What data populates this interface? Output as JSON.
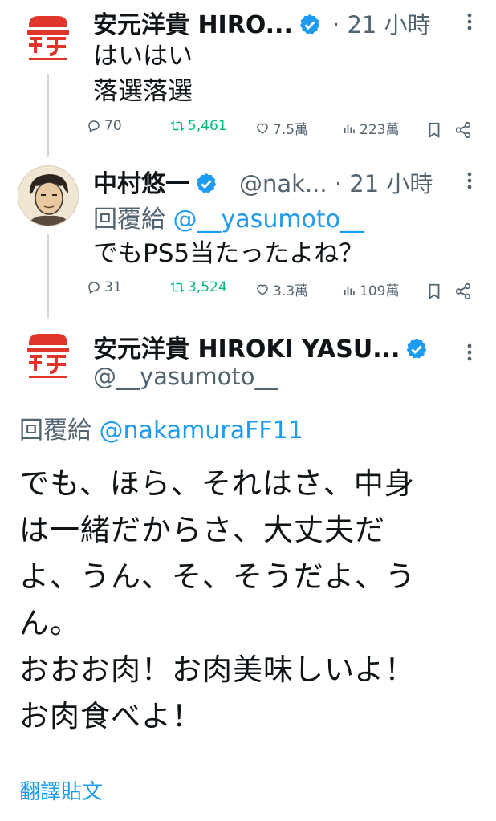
{
  "tweets": [
    {
      "name": "安元洋貴 HIRO...",
      "dot": "·",
      "time": "21 小時",
      "text_lines": [
        "はいはい",
        "落選落選"
      ],
      "stats": {
        "replies": "70",
        "retweets": "5,461",
        "likes": "7.5萬",
        "views": "223萬"
      }
    },
    {
      "name": "中村悠一",
      "handle": "@nak...",
      "dot": "·",
      "time": "21 小時",
      "reply_prefix": "回覆給",
      "reply_to": "@__yasumoto__",
      "text_lines": [
        "でもPS5当たったよね？"
      ],
      "stats": {
        "replies": "31",
        "retweets": "3,524",
        "likes": "3.3萬",
        "views": "109萬"
      }
    }
  ],
  "main_tweet": {
    "name": "安元洋貴 HIROKI YASU...",
    "handle": "@__yasumoto__",
    "reply_prefix": "回覆給",
    "reply_to": "@nakamuraFF11",
    "text_lines": [
      "でも、ほら、それはさ、中身",
      "は一緒だからさ、大丈夫だ",
      "よ、うん、そ、そうだよ、う",
      "ん。",
      "おおお肉！お肉美味しいよ！",
      "お肉食べよ！"
    ],
    "translate_label": "翻譯貼文"
  },
  "colors": {
    "accent": "#1d9bf0",
    "retweet": "#00ba7c",
    "muted": "#536471",
    "logo_red": "#e0352b",
    "verified": "#1d9bf0"
  },
  "icons": [
    "reply-icon",
    "retweet-icon",
    "like-icon",
    "views-icon",
    "bookmark-icon",
    "share-icon",
    "more-icon",
    "verified-badge-icon"
  ]
}
